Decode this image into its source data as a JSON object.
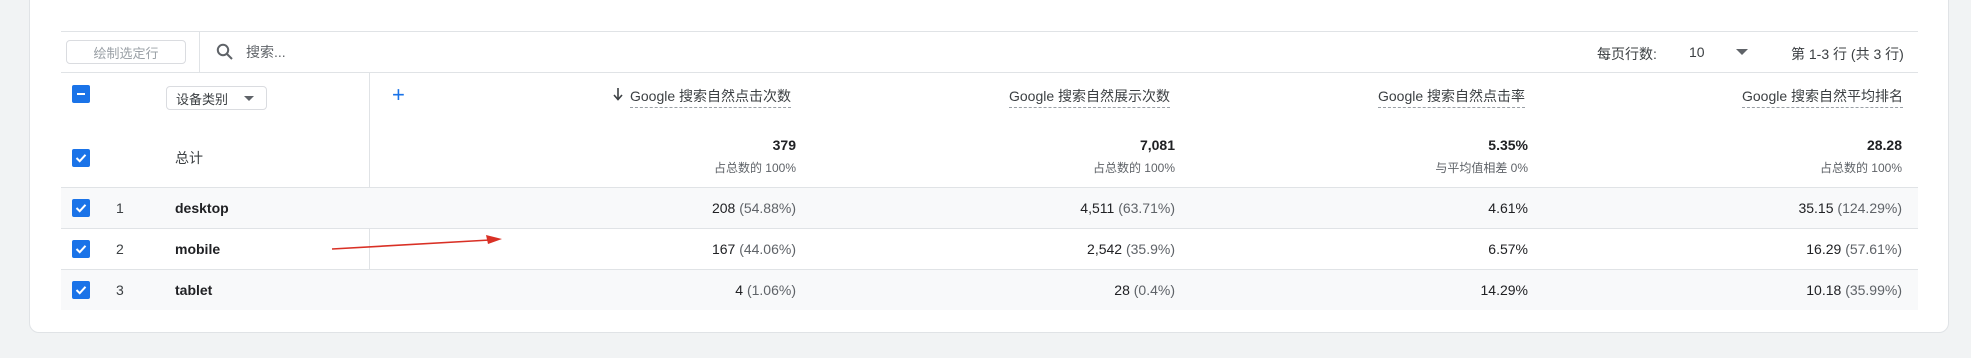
{
  "legend": {
    "items": [
      "总计",
      "desktop",
      "mobile",
      "tablet"
    ]
  },
  "toolbar": {
    "plot_rows_label": "绘制选定行",
    "search_placeholder": "搜索...",
    "rows_per_page_label": "每页行数:",
    "rows_per_page_value": "10",
    "range_text": "第 1-3 行 (共 3 行)"
  },
  "table": {
    "dimension_select": "设备类别",
    "columns": [
      "Google 搜索自然点击次数",
      "Google 搜索自然展示次数",
      "Google 搜索自然点击率",
      "Google 搜索自然平均排名"
    ],
    "total": {
      "label": "总计",
      "values": [
        "379",
        "7,081",
        "5.35%",
        "28.28"
      ],
      "subs": [
        "占总数的 100%",
        "占总数的 100%",
        "与平均值相差 0%",
        "占总数的 100%"
      ]
    },
    "rows": [
      {
        "index": "1",
        "dim": "desktop",
        "cells": [
          [
            "208",
            "(54.88%)"
          ],
          [
            "4,511",
            "(63.71%)"
          ],
          [
            "4.61%",
            ""
          ],
          [
            "35.15",
            "(124.29%)"
          ]
        ]
      },
      {
        "index": "2",
        "dim": "mobile",
        "cells": [
          [
            "167",
            "(44.06%)"
          ],
          [
            "2,542",
            "(35.9%)"
          ],
          [
            "6.57%",
            ""
          ],
          [
            "16.29",
            "(57.61%)"
          ]
        ]
      },
      {
        "index": "3",
        "dim": "tablet",
        "cells": [
          [
            "4",
            "(1.06%)"
          ],
          [
            "28",
            "(0.4%)"
          ],
          [
            "14.29%",
            ""
          ],
          [
            "10.18",
            "(35.99%)"
          ]
        ]
      }
    ]
  },
  "colors": {
    "accent": "#1a73e8",
    "annotation_arrow": "#d93025"
  }
}
